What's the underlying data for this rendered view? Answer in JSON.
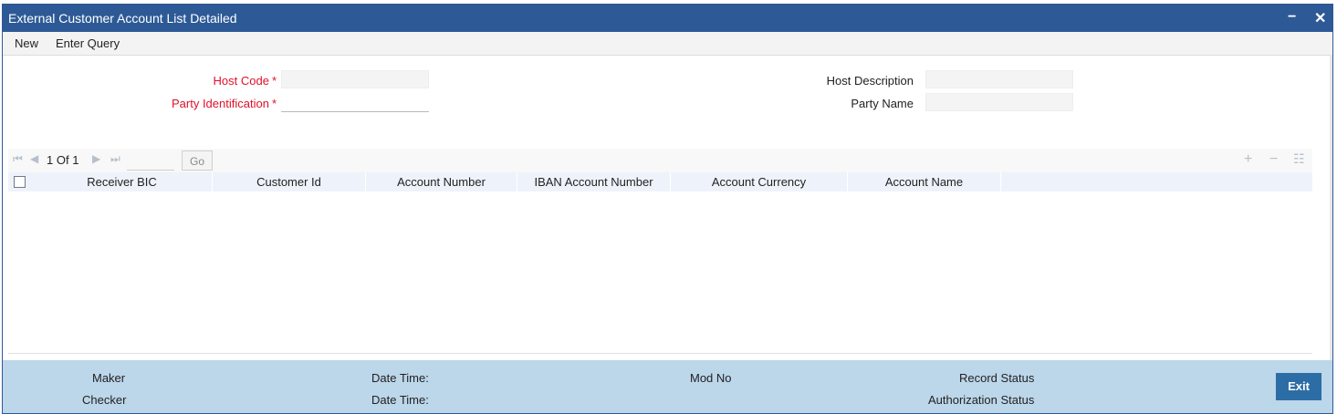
{
  "window": {
    "title": "External Customer Account List Detailed",
    "minimize": "−",
    "close": "✕"
  },
  "menu": {
    "new": "New",
    "enter_query": "Enter Query"
  },
  "form": {
    "host_code_label": "Host Code",
    "party_identification_label": "Party Identification",
    "host_description_label": "Host Description",
    "party_name_label": "Party Name",
    "required_mark": "*"
  },
  "grid": {
    "page_current": "1",
    "page_of": "Of",
    "page_total": "1",
    "go_label": "Go",
    "columns": [
      "Receiver BIC",
      "Customer Id",
      "Account Number",
      "IBAN Account Number",
      "Account Currency",
      "Account Name"
    ]
  },
  "footer": {
    "maker": "Maker",
    "checker": "Checker",
    "date_time_1": "Date Time:",
    "date_time_2": "Date Time:",
    "mod_no": "Mod No",
    "record_status": "Record Status",
    "authorization_status": "Authorization Status",
    "exit_label": "Exit"
  },
  "colors": {
    "title_bar": "#2d5a96",
    "footer": "#bcd6ea",
    "required": "#e0102a",
    "exit_button": "#2d6da5"
  }
}
